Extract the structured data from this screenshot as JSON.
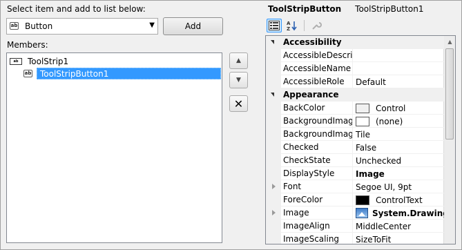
{
  "left": {
    "select_label": "Select item and add to list below:",
    "combo_value": "Button",
    "combo_icon": "ab",
    "add_label": "Add",
    "members_label": "Members:",
    "tree": [
      {
        "label": "ToolStrip1",
        "icon": "toolstrip-icon",
        "icon_text": "ab"
      },
      {
        "label": "ToolStripButton1",
        "icon": "button-icon",
        "icon_text": "ab",
        "selected": true
      }
    ],
    "side_buttons": {
      "move_up": "▲",
      "move_down": "▼",
      "delete": "✕"
    }
  },
  "right": {
    "title_type": "ToolStripButton",
    "title_name": "ToolStripButton1",
    "toolbar": {
      "categorized": "categorized-icon",
      "alphabetical": "alphabetical-icon",
      "property_pages": "wrench-icon"
    },
    "rows": [
      {
        "type": "cat",
        "label": "Accessibility"
      },
      {
        "type": "prop",
        "name": "AccessibleDescriptio",
        "value": ""
      },
      {
        "type": "prop",
        "name": "AccessibleName",
        "value": ""
      },
      {
        "type": "prop",
        "name": "AccessibleRole",
        "value": "Default"
      },
      {
        "type": "cat",
        "label": "Appearance"
      },
      {
        "type": "prop",
        "name": "BackColor",
        "value": "Control",
        "swatch": "#f0f0f0"
      },
      {
        "type": "prop",
        "name": "BackgroundImage",
        "value": "(none)",
        "swatch": "#ffffff"
      },
      {
        "type": "prop",
        "name": "BackgroundImageL",
        "value": "Tile"
      },
      {
        "type": "prop",
        "name": "Checked",
        "value": "False"
      },
      {
        "type": "prop",
        "name": "CheckState",
        "value": "Unchecked"
      },
      {
        "type": "prop",
        "name": "DisplayStyle",
        "value": "Image",
        "bold": true
      },
      {
        "type": "prop",
        "name": "Font",
        "value": "Segoe UI, 9pt",
        "expandable": true
      },
      {
        "type": "prop",
        "name": "ForeColor",
        "value": "ControlText",
        "swatch": "#000000"
      },
      {
        "type": "prop",
        "name": "Image",
        "value": "System.Drawing.B",
        "bold": true,
        "expandable": true,
        "image": true
      },
      {
        "type": "prop",
        "name": "ImageAlign",
        "value": "MiddleCenter"
      },
      {
        "type": "prop",
        "name": "ImageScaling",
        "value": "SizeToFit"
      }
    ]
  },
  "colors": {
    "selection": "#3399ff",
    "category_bg": "#f0f0f0",
    "window_bg": "#f0f0f0"
  }
}
